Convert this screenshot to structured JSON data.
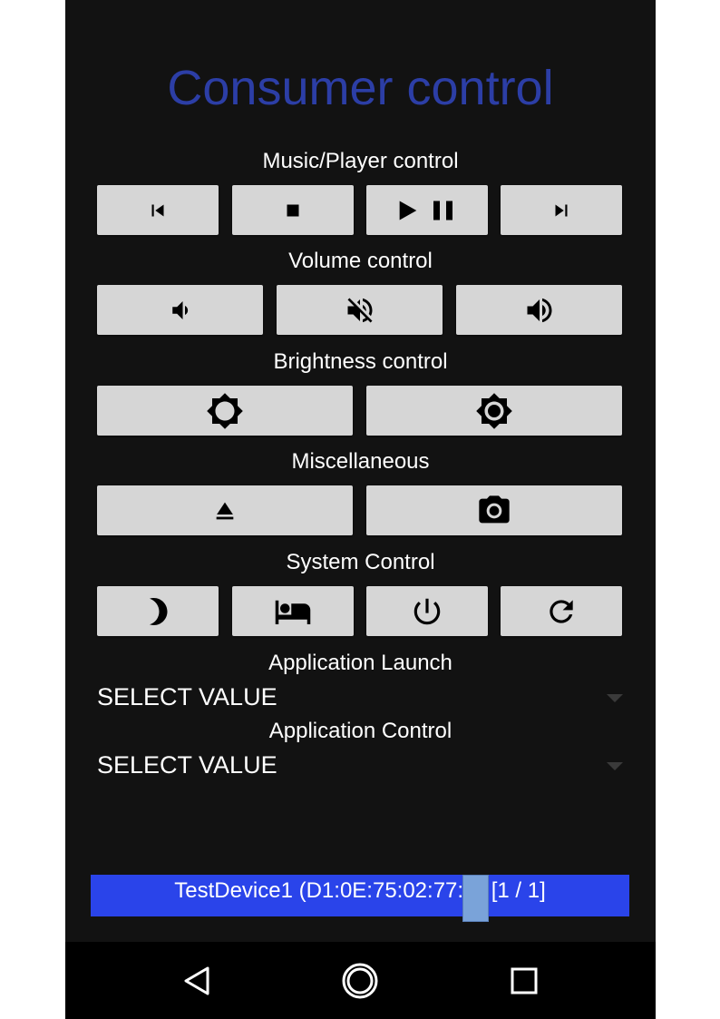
{
  "app": {
    "title": "Consumer control"
  },
  "sections": {
    "music": "Music/Player control",
    "volume": "Volume control",
    "brightness": "Brightness control",
    "misc": "Miscellaneous",
    "system": "System Control",
    "app_launch": "Application Launch",
    "app_control": "Application Control"
  },
  "icons": {
    "music": [
      "skip-previous-icon",
      "stop-icon",
      "play-pause-icon",
      "skip-next-icon"
    ],
    "volume": [
      "volume-down-icon",
      "volume-mute-icon",
      "volume-up-icon"
    ],
    "brightness": [
      "brightness-low-icon",
      "brightness-high-icon"
    ],
    "misc": [
      "eject-icon",
      "camera-icon"
    ],
    "system": [
      "sleep-moon-icon",
      "hotel-bed-icon",
      "power-icon",
      "refresh-icon"
    ],
    "nav": [
      "back-icon",
      "home-icon",
      "recents-icon"
    ]
  },
  "dropdowns": {
    "app_launch": {
      "value": "SELECT VALUE"
    },
    "app_control": {
      "value": "SELECT VALUE"
    }
  },
  "status": {
    "device": "TestDevice1  (D1:0E:75:02:77:",
    "suffix": ") [1 / 1]"
  },
  "colors": {
    "title": "#2c3ea6",
    "background": "#121212",
    "button": "#d6d6d6",
    "status_bar": "#2a44ea",
    "navbar": "#000000"
  }
}
